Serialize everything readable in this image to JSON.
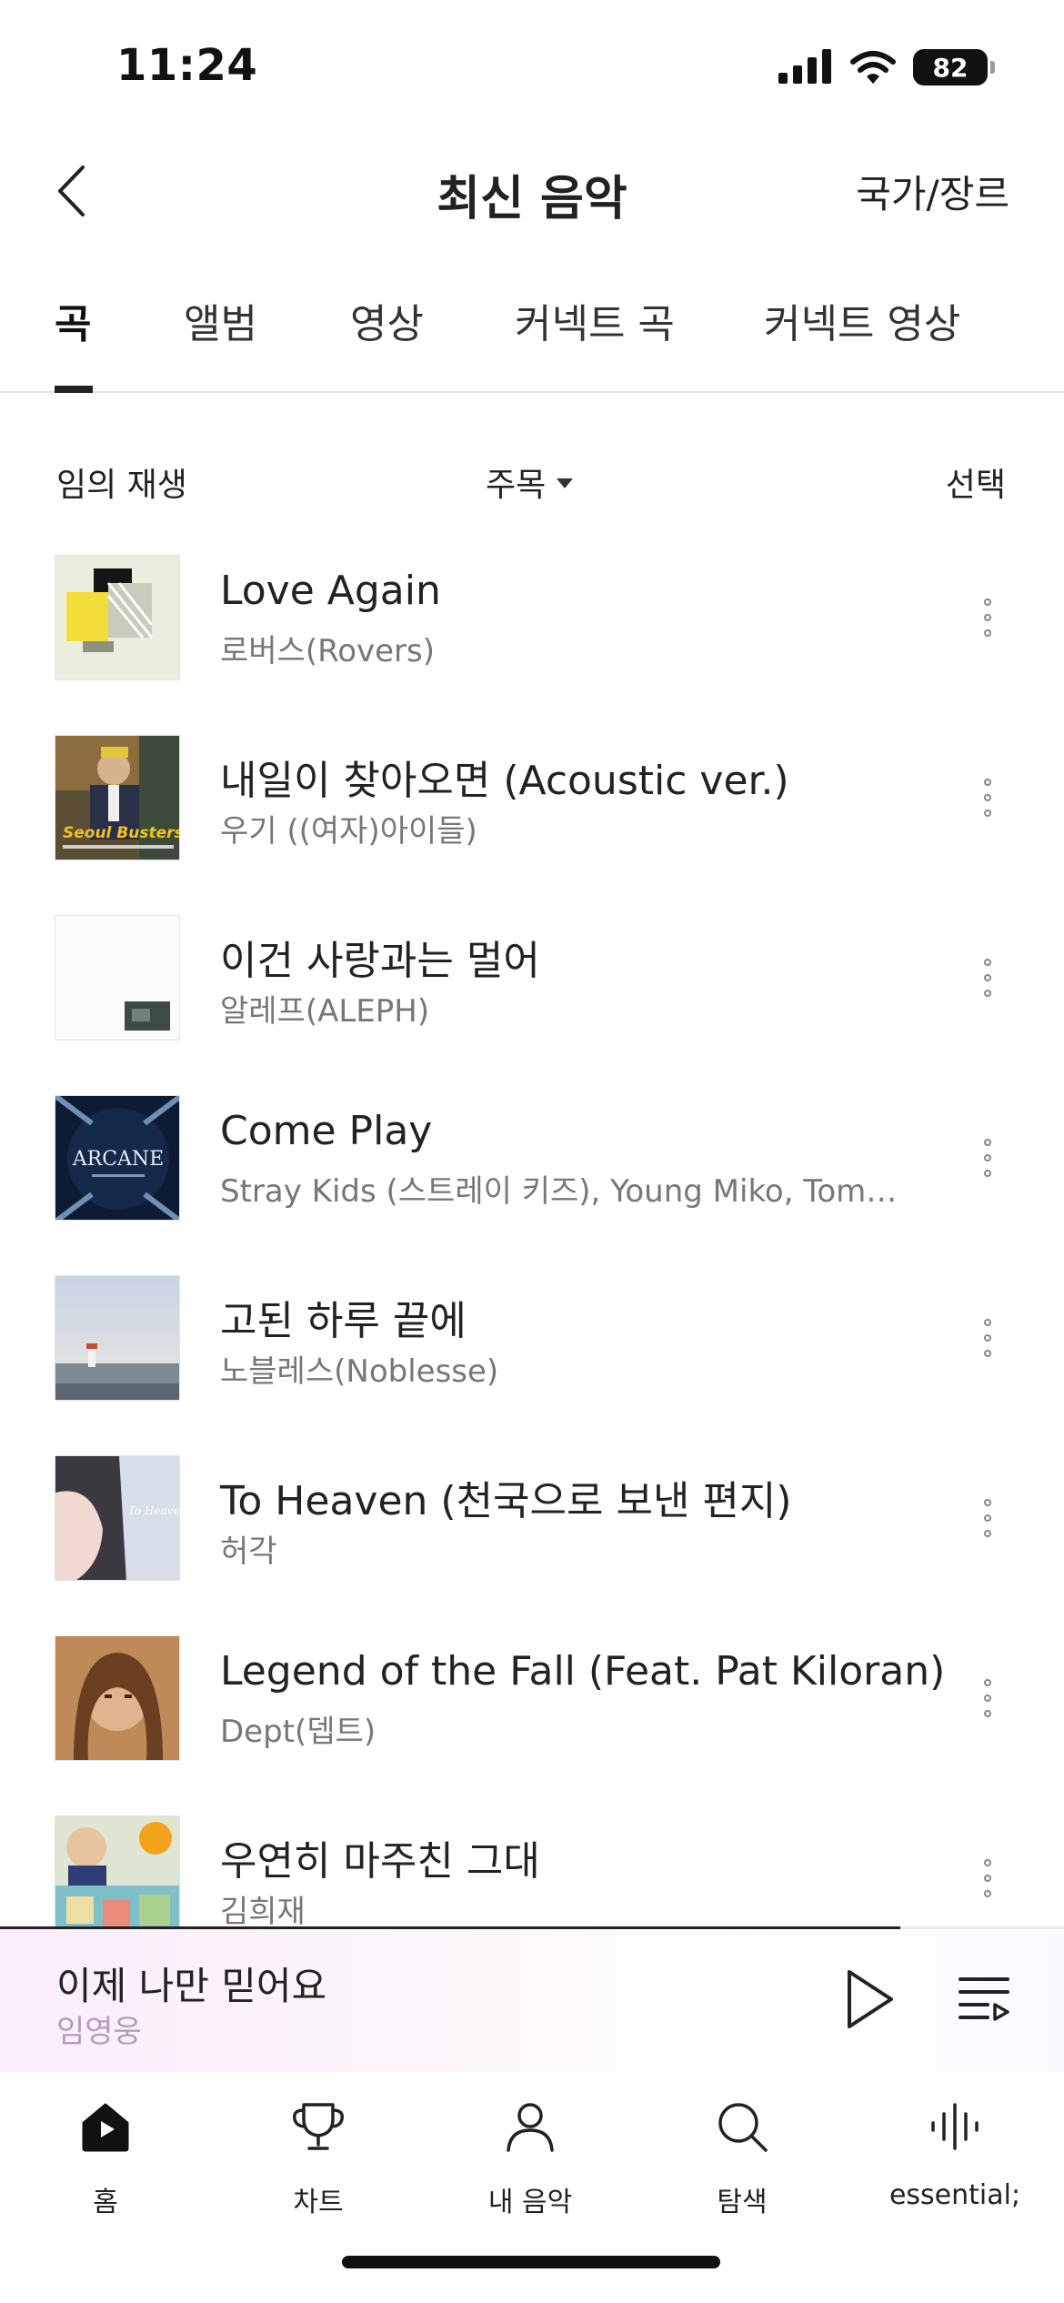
{
  "status": {
    "time": "11:24",
    "battery": "82"
  },
  "header": {
    "title": "최신 음악",
    "right_link": "국가/장르"
  },
  "tabs": [
    {
      "label": "곡",
      "active": true
    },
    {
      "label": "앨범"
    },
    {
      "label": "영상"
    },
    {
      "label": "커넥트 곡"
    },
    {
      "label": "커넥트 영상"
    }
  ],
  "controls": {
    "shuffle": "임의 재생",
    "sort": "주목",
    "select": "선택"
  },
  "songs": [
    {
      "title": "Love Again",
      "artist": "로버스(Rovers)"
    },
    {
      "title": "내일이 찾아오면 (Acoustic ver.)",
      "artist": "우기 ((여자)아이들)"
    },
    {
      "title": "이건 사랑과는 멀어",
      "artist": "알레프(ALEPH)"
    },
    {
      "title": "Come Play",
      "artist": "Stray Kids (스트레이 키즈), Young Miko, Tom…"
    },
    {
      "title": "고된 하루 끝에",
      "artist": "노블레스(Noblesse)"
    },
    {
      "title": "To Heaven (천국으로 보낸 편지)",
      "artist": "허각"
    },
    {
      "title": "Legend of the Fall (Feat. Pat Kiloran)",
      "artist": "Dept(뎁트)"
    },
    {
      "title": "우연히 마주친 그대",
      "artist": "김희재"
    }
  ],
  "art_text": {
    "seoul_busters": "Seoul Busters",
    "arcane": "ARCANE",
    "to_heaven": "To Heaven"
  },
  "now_playing": {
    "title": "이제 나만 믿어요",
    "artist": "임영웅"
  },
  "nav": [
    {
      "label": "홈",
      "icon": "home-icon"
    },
    {
      "label": "차트",
      "icon": "trophy-icon"
    },
    {
      "label": "내 음악",
      "icon": "person-icon"
    },
    {
      "label": "탐색",
      "icon": "search-icon"
    },
    {
      "label": "essential;",
      "icon": "waveform-icon"
    }
  ],
  "colors": {
    "accent": "#222222",
    "secondary_text": "#777777",
    "now_artist": "#b59abf"
  }
}
